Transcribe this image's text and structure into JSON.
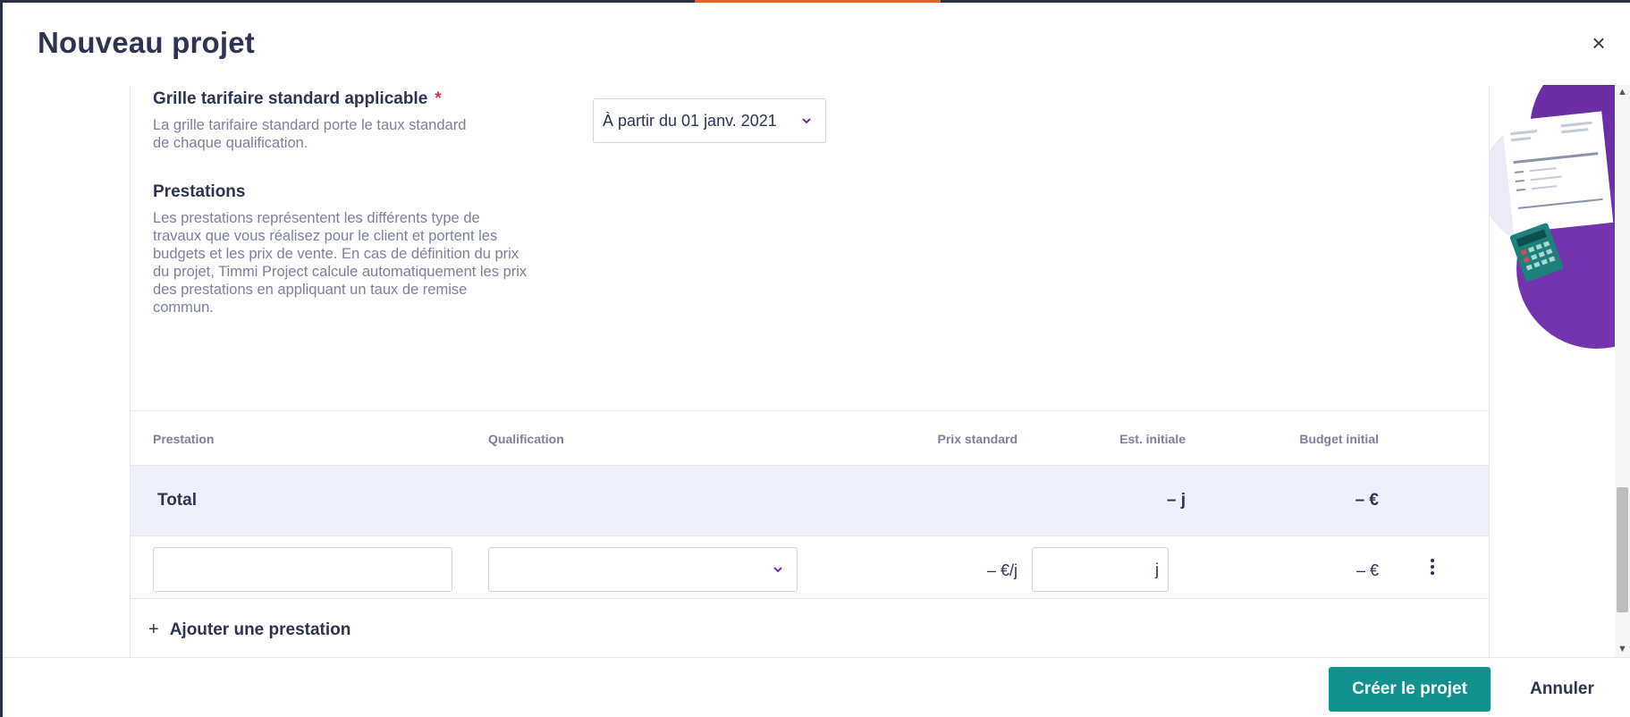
{
  "modal": {
    "title": "Nouveau projet",
    "close_label": "×"
  },
  "grille": {
    "title": "Grille tarifaire standard applicable",
    "required_mark": "*",
    "description": "La grille tarifaire standard porte le taux standard de chaque qualification.",
    "selected_value": "À partir du 01 janv. 2021"
  },
  "prestations": {
    "title": "Prestations",
    "description": "Les prestations représentent les différents type de travaux que vous réalisez pour le client et portent les budgets et les prix de vente. En cas de définition du prix du projet, Timmi Project calcule automatiquement les prix des prestations en appliquant un taux de remise commun."
  },
  "table": {
    "headers": {
      "prestation": "Prestation",
      "qualification": "Qualification",
      "prix_standard": "Prix standard",
      "est_initiale": "Est. initiale",
      "budget_initial": "Budget initial"
    },
    "total": {
      "label": "Total",
      "est_value": "–  j",
      "budget_value": "–  €"
    },
    "row": {
      "prestation_value": "",
      "qualification_value": "",
      "prix_standard": "–  €/j",
      "est_unit": "j",
      "budget": "–  €"
    },
    "add_label": "Ajouter une prestation",
    "add_symbol": "+"
  },
  "footer": {
    "create_label": "Créer le projet",
    "cancel_label": "Annuler"
  },
  "colors": {
    "primary": "#12918e",
    "text": "#2c3452",
    "muted": "#7b8299",
    "accent_purple": "#6b2fa3"
  }
}
